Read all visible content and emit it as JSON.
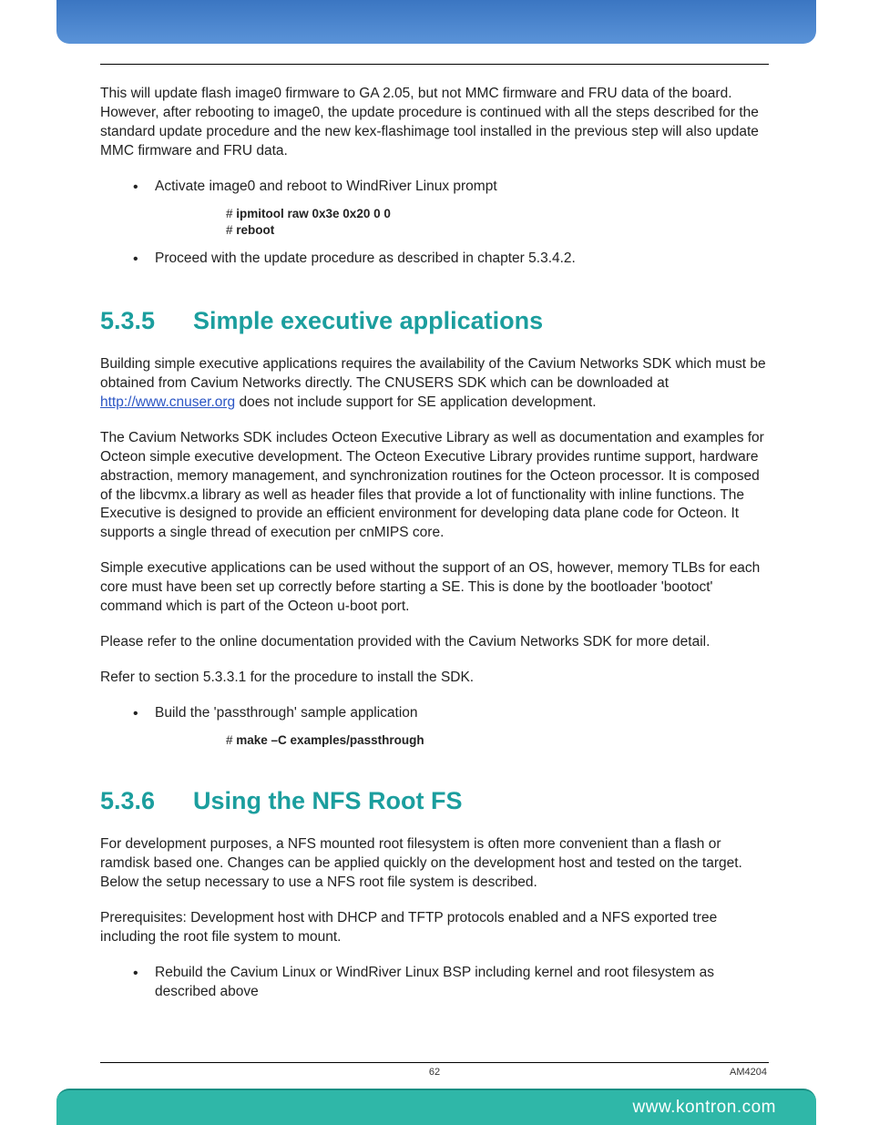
{
  "intro_para": "This will update flash image0 firmware to GA 2.05, but not MMC firmware and FRU data of the board. However, after rebooting to image0, the update procedure is continued with all the steps described for the standard update procedure and the new kex-flashimage tool installed in the previous step will also update MMC firmware and FRU data.",
  "bullets_a": {
    "b1": "Activate image0 and reboot to WindRiver Linux prompt",
    "code1_l1": "ipmitool raw 0x3e 0x20 0 0",
    "code1_l2": "reboot",
    "b2": "Proceed with the update procedure as described in chapter 5.3.4.2."
  },
  "sec535": {
    "num": "5.3.5",
    "title": "Simple executive applications",
    "p1a": "Building simple executive applications requires the availability of the Cavium Networks SDK which must be obtained from Cavium Networks directly. The CNUSERS SDK which can be downloaded at ",
    "link": "http://www.cnuser.org",
    "p1b": " does not include support for SE application development.",
    "p2": "The Cavium Networks SDK includes Octeon Executive Library as well as documentation and examples for Octeon simple executive development. The Octeon Executive Library provides runtime support, hardware abstraction, memory management, and synchronization routines for the Octeon processor. It is composed of the libcvmx.a library as well as header files that provide a lot of functionality with inline functions. The Executive is designed to provide an efficient environment for developing data plane code for Octeon. It supports a single thread of execution per cnMIPS core.",
    "p3": "Simple executive applications can be used without the support of an OS, however, memory TLBs for each core must have been set up correctly before starting a SE. This is done by the bootloader 'bootoct' command which is part of the Octeon u-boot port.",
    "p4": "Please refer to the online documentation provided with the Cavium Networks SDK for more detail.",
    "p5": "Refer to section 5.3.3.1 for the procedure to install the SDK.",
    "b1": "Build the 'passthrough' sample application",
    "code1": "make –C examples/passthrough"
  },
  "sec536": {
    "num": "5.3.6",
    "title": "Using the NFS Root FS",
    "p1": "For development purposes, a NFS mounted root filesystem is often more convenient than a flash or ramdisk based one. Changes can be applied quickly on the development host and tested on the target. Below the setup necessary to use a NFS root file system is described.",
    "p2": "Prerequisites: Development host with DHCP and TFTP protocols enabled and a NFS exported tree including the root file system to mount.",
    "b1": "Rebuild the Cavium Linux or WindRiver Linux BSP including kernel and root filesystem as described above"
  },
  "footer": {
    "page": "62",
    "doc": "AM4204",
    "url": "www.kontron.com"
  }
}
